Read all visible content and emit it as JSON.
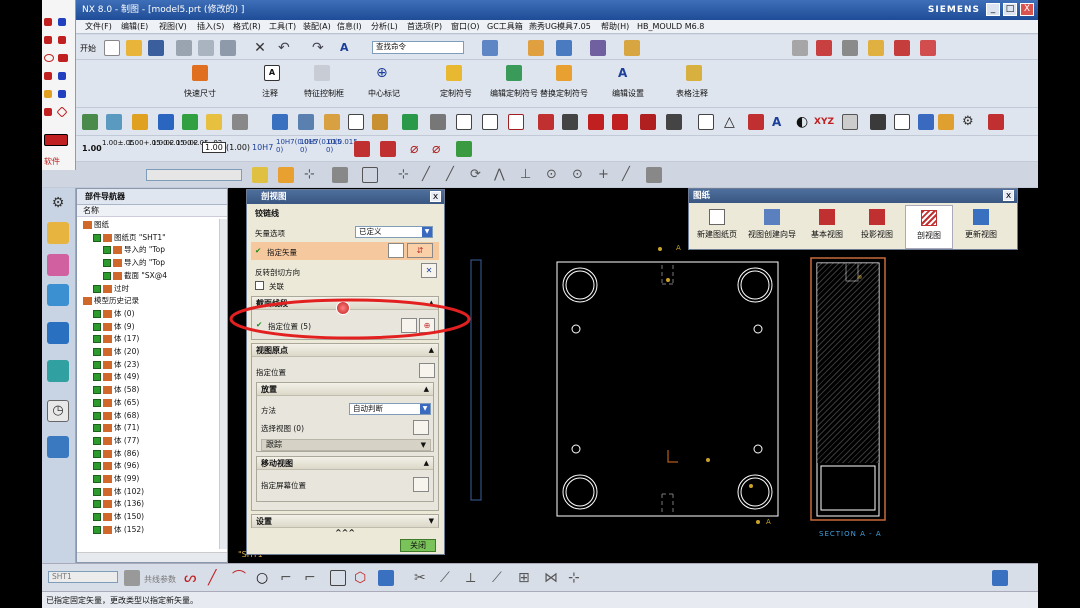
{
  "window": {
    "title": "NX 8.0 - 制图 - [model5.prt  (修改的) ]",
    "brand": "SIEMENS",
    "min": "_",
    "max": "□",
    "close": "X"
  },
  "menu": [
    "文件(F)",
    "编辑(E)",
    "视图(V)",
    "插入(S)",
    "格式(R)",
    "工具(T)",
    "装配(A)",
    "信息(I)",
    "分析(L)",
    "首选项(P)",
    "窗口(O)",
    "GC工具箱",
    "燕秀UG模具7.05",
    "帮助(H)",
    "HB_MOULD M6.8"
  ],
  "toolbar": {
    "start_label": "开始",
    "search_placeholder": "查找命令"
  },
  "ribbon": [
    "快速尺寸",
    "注释",
    "特征控制框",
    "中心标记",
    "定制符号",
    "编辑定制符号",
    "替换定制符号",
    "编辑设置",
    "表格注释"
  ],
  "tolerance_row": [
    "1.00",
    "1.00±.05",
    "1.00+.05-.02",
    "1.00+.05-.02",
    "1.00+.05-.02",
    "1.00",
    "(1.00)",
    "10H7",
    "10H7(0.015 0)",
    "10H7(0.015 0)",
    "10(0.015 0)"
  ],
  "left_strip": {
    "label": "软件"
  },
  "navigator": {
    "title": "部件导航器",
    "column": "名称",
    "nodes": [
      {
        "text": "图纸",
        "indent": 0
      },
      {
        "text": "图纸页 \"SHT1\"",
        "indent": 1
      },
      {
        "text": "导入的 \"Top",
        "indent": 2
      },
      {
        "text": "导入的 \"Top",
        "indent": 2
      },
      {
        "text": "截面 \"SX@4",
        "indent": 2
      },
      {
        "text": "过时",
        "indent": 1
      },
      {
        "text": "模型历史记录",
        "indent": 0
      },
      {
        "text": "体 (0)",
        "indent": 1
      },
      {
        "text": "体 (9)",
        "indent": 1
      },
      {
        "text": "体 (17)",
        "indent": 1
      },
      {
        "text": "体 (20)",
        "indent": 1
      },
      {
        "text": "体 (23)",
        "indent": 1
      },
      {
        "text": "体 (49)",
        "indent": 1
      },
      {
        "text": "体 (58)",
        "indent": 1
      },
      {
        "text": "体 (65)",
        "indent": 1
      },
      {
        "text": "体 (68)",
        "indent": 1
      },
      {
        "text": "体 (71)",
        "indent": 1
      },
      {
        "text": "体 (77)",
        "indent": 1
      },
      {
        "text": "体 (86)",
        "indent": 1
      },
      {
        "text": "体 (96)",
        "indent": 1
      },
      {
        "text": "体 (99)",
        "indent": 1
      },
      {
        "text": "体 (102)",
        "indent": 1
      },
      {
        "text": "体 (136)",
        "indent": 1
      },
      {
        "text": "体 (150)",
        "indent": 1
      },
      {
        "text": "体 (152)",
        "indent": 1
      }
    ]
  },
  "section_dialog": {
    "title": "剖视图",
    "hinge_section": "铰链线",
    "vector_option_label": "矢量选项",
    "vector_option_value": "已定义",
    "specify_vector": "指定矢量",
    "reverse_dir": "反转剖切方向",
    "associative": "关联",
    "cut_segment_section": "截面线段",
    "specify_location": "指定位置 (5)",
    "view_origin_section": "视图原点",
    "specify_position": "指定位置",
    "placement_section": "放置",
    "method_label": "方法",
    "method_value": "自动判断",
    "select_view": "选择视图 (0)",
    "tracking": "跟踪",
    "move_view_section": "移动视图",
    "specify_screen_pos": "指定屏幕位置",
    "settings_section": "设置",
    "more": "^^^",
    "close_button": "关闭"
  },
  "drawing_toolbar": {
    "title": "图纸",
    "buttons": [
      "新建图纸页",
      "视图创建向导",
      "基本视图",
      "投影视图",
      "剖视图",
      "更新视图"
    ]
  },
  "canvas": {
    "sheet_label": "\"SHT1\"",
    "section_label": "SECTION A - A",
    "marker_a": "A"
  },
  "bottom": {
    "sheet_field": "SHT1",
    "lock_label": "共线参数"
  },
  "status_text": "已指定固定矢量，更改类型以指定新矢量。",
  "colors": {
    "title_bar": "#1f4c96",
    "highlight_circle": "#e32020",
    "vector_row": "#f6c89e",
    "geometry": "#ffffff",
    "tick": "#c9a227"
  }
}
